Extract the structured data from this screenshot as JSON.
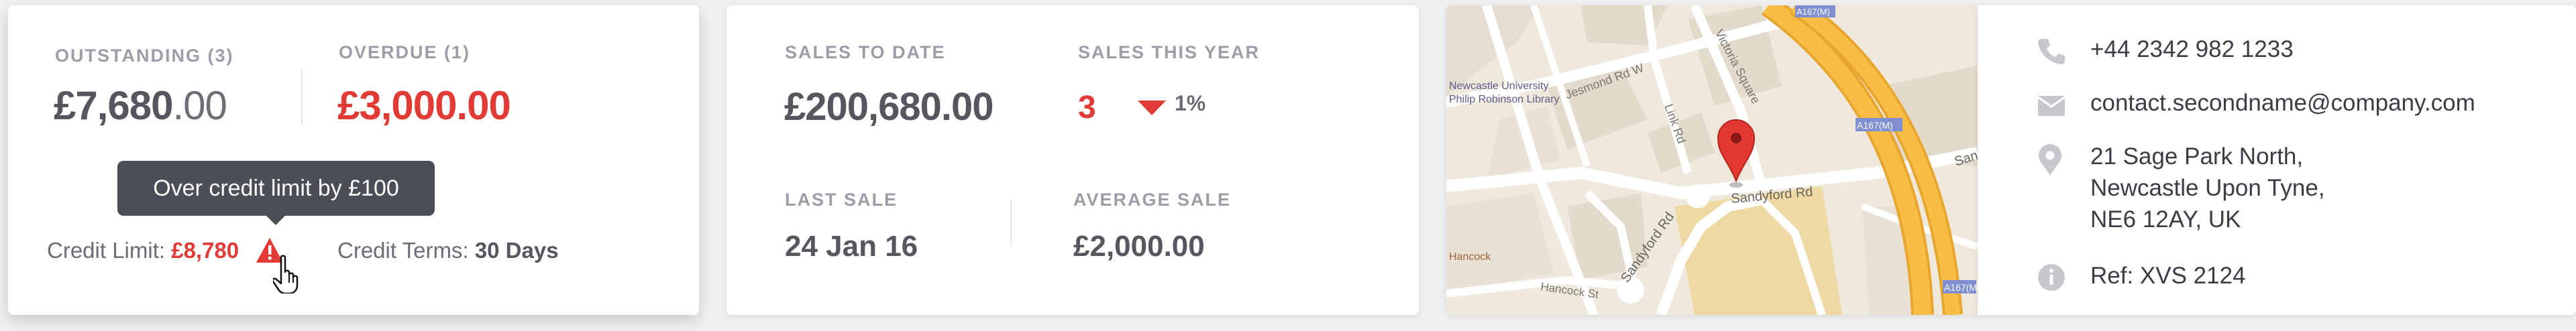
{
  "account": {
    "outstanding_label": "OUTSTANDING (3)",
    "outstanding_int": "£7,680",
    "outstanding_dec": ".00",
    "overdue_label": "OVERDUE (1)",
    "overdue_value": "£3,000.00",
    "tooltip": "Over credit limit by £100",
    "credit_limit_label": "Credit Limit:",
    "credit_limit_value": "£8,780",
    "credit_terms_label": "Credit Terms:",
    "credit_terms_value": "30 Days"
  },
  "sales": {
    "to_date_label": "SALES TO DATE",
    "to_date_value": "£200,680.00",
    "this_year_label": "SALES THIS YEAR",
    "this_year_value": "3",
    "this_year_change": "1%",
    "last_sale_label": "LAST SALE",
    "last_sale_value": "24 Jan 16",
    "average_label": "AVERAGE SALE",
    "average_value": "£2,000.00"
  },
  "map": {
    "streets": [
      "Victoria Square",
      "Jesmond Rd W",
      "Link Rd",
      "Sandyford Rd",
      "Sandyford Rd",
      "Sand",
      "Hancock St",
      "A167(M)",
      "A167(M)",
      "A167(M)"
    ],
    "poi_newcastle_1": "Newcastle University",
    "poi_newcastle_2": "Philip Robinson Library",
    "poi_hancock": "Hancock"
  },
  "contact": {
    "phone": "+44 2342 982 1233",
    "email": "contact.secondname@company.com",
    "address_line1": "21 Sage Park North,",
    "address_line2": "Newcastle Upon Tyne,",
    "address_line3": "NE6 12AY, UK",
    "ref": "Ref: XVS 2124"
  },
  "colors": {
    "accent_red": "#e23b35",
    "text_dark": "#55565e",
    "label_grey": "#9c9da6",
    "tooltip_bg": "#4c4e57",
    "map_road_orange": "#f5a623"
  }
}
